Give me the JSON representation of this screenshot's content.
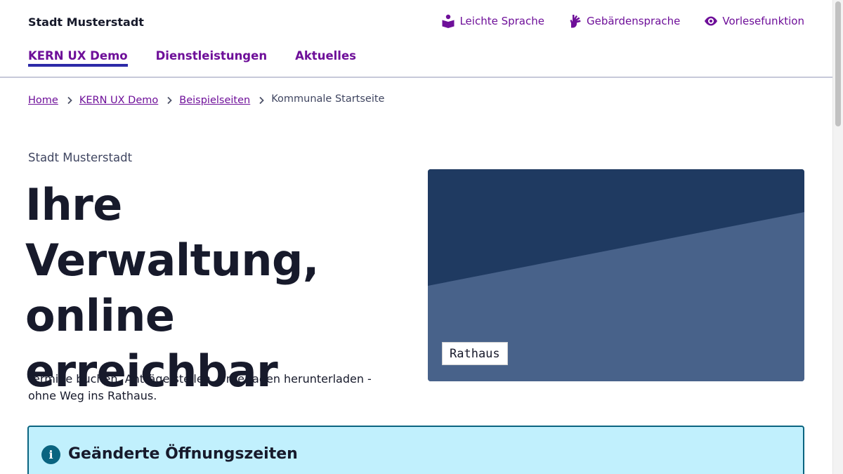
{
  "header": {
    "site_name": "Stadt Musterstadt",
    "accessibility_links": [
      {
        "label": "Leichte Sprache",
        "icon": "easy-language-icon"
      },
      {
        "label": "Gebärdensprache",
        "icon": "sign-language-icon"
      },
      {
        "label": "Vorlesefunktion",
        "icon": "eye-icon"
      }
    ]
  },
  "nav": {
    "items": [
      {
        "label": "KERN UX Demo",
        "active": true
      },
      {
        "label": "Dienstleistungen",
        "active": false
      },
      {
        "label": "Aktuelles",
        "active": false
      }
    ]
  },
  "breadcrumb": {
    "links": [
      "Home",
      "KERN UX Demo",
      "Beispielseiten"
    ],
    "current": "Kommunale Startseite"
  },
  "hero": {
    "eyebrow": "Stadt Musterstadt",
    "title": "Ihre Verwaltung, online erreichbar",
    "text": "Termine buchen, Anträge stellen, Unterlagen herunterladen - ohne Weg ins Rathaus.",
    "image_caption": "Rathaus"
  },
  "notice": {
    "icon": "info-icon",
    "title": "Geänderte Öffnungszeiten"
  },
  "colors": {
    "link": "#6e0f99",
    "active_underline": "#2c2aa8",
    "hero_dark": "#1f3a61",
    "hero_light": "#48628a",
    "notice_bg": "#c1f0fd",
    "notice_border": "#0a6480"
  }
}
